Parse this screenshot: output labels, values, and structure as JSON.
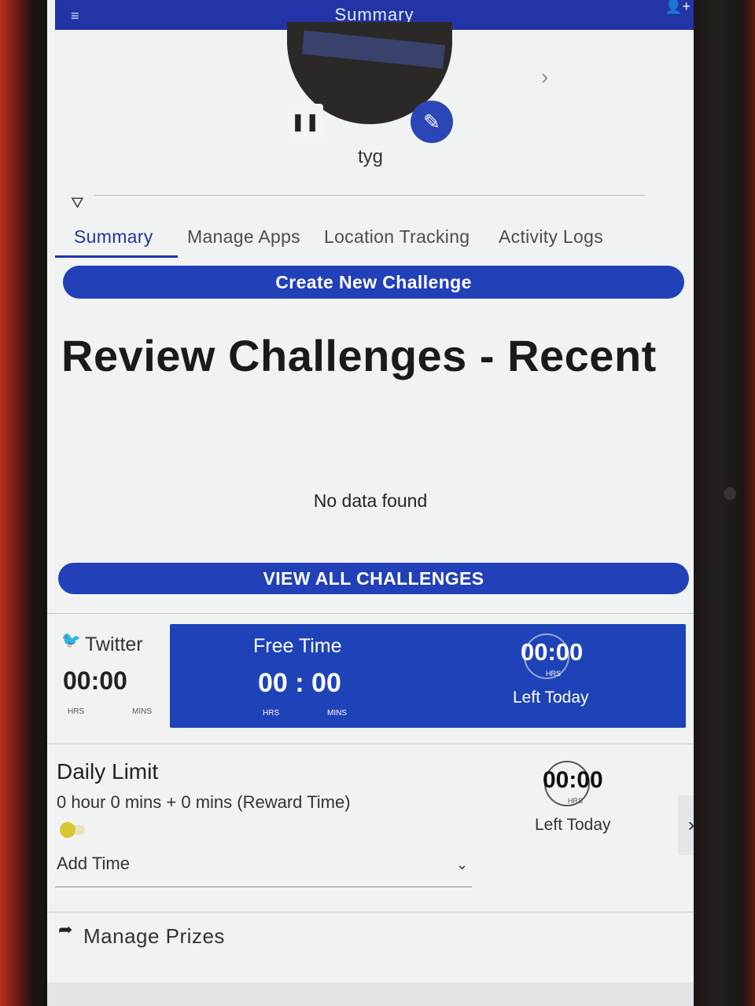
{
  "appbar": {
    "title": "Summary",
    "menu_icon": "menu-icon",
    "add_user_icon": "add-user-icon"
  },
  "profile": {
    "username": "tyg",
    "pause_symbol": "❚❚",
    "edit_symbol": "✎",
    "next_symbol": "›"
  },
  "filter": {
    "icon": "filter-icon",
    "symbol": "⛛"
  },
  "tabs": [
    {
      "label": "Summary",
      "active": true
    },
    {
      "label": "Manage Apps",
      "active": false
    },
    {
      "label": "Location Tracking",
      "active": false
    },
    {
      "label": "Activity Logs",
      "active": false
    }
  ],
  "buttons": {
    "create_challenge": "Create New Challenge",
    "view_all": "VIEW ALL CHALLENGES"
  },
  "challenges": {
    "title": "Review Challenges - Recent",
    "empty_text": "No data found"
  },
  "twitter": {
    "label": "Twitter",
    "time": "00:00",
    "hrs_unit": "HRS",
    "mins_unit": "MINS"
  },
  "free_time": {
    "label": "Free Time",
    "time": "00 : 00",
    "hrs_unit": "HRS",
    "mins_unit": "MINS",
    "left_time": "00:00",
    "left_hrs": "HRS",
    "left_label": "Left Today"
  },
  "daily_limit": {
    "title": "Daily Limit",
    "subtitle": "0 hour 0 mins + 0 mins (Reward Time)",
    "left_time": "00:00",
    "left_hrs": "HRS",
    "left_label": "Left Today",
    "next_symbol": "›",
    "add_time_label": "Add Time",
    "chevron": "⌄"
  },
  "prizes": {
    "label": "Manage Prizes",
    "icon_symbol": "➦"
  },
  "colors": {
    "primary": "#2234a6",
    "button": "#2240b8",
    "card": "#1e43b8",
    "toggle": "#d9c632"
  }
}
